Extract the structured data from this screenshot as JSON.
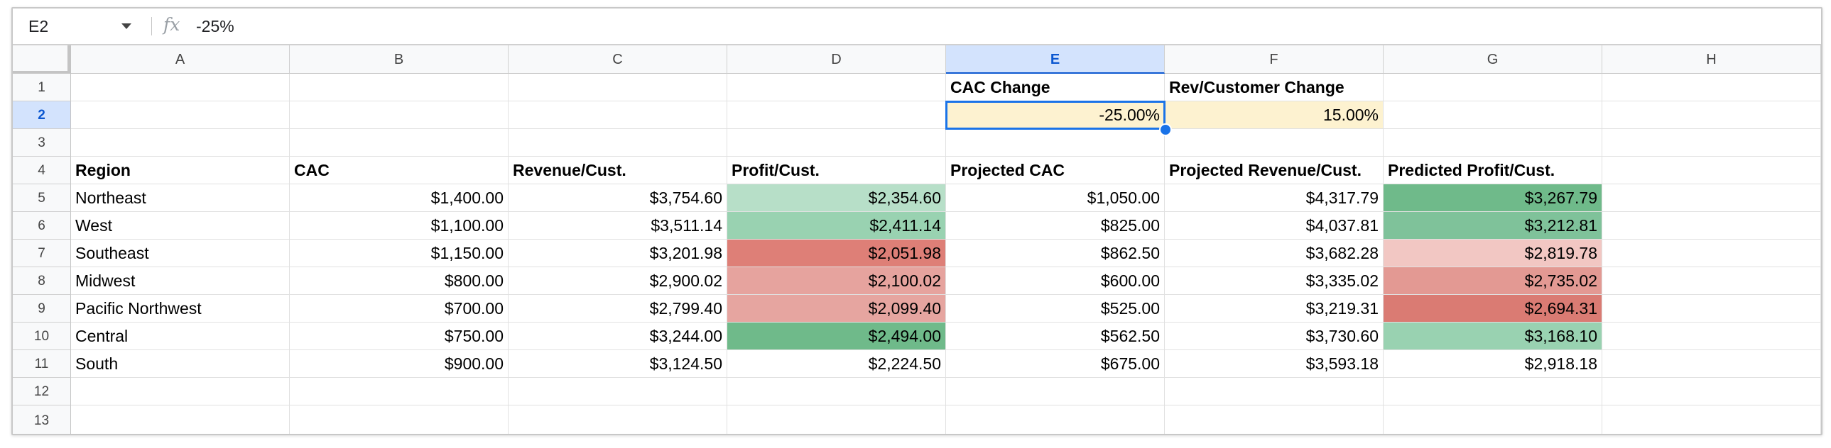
{
  "formula_bar": {
    "cell_ref": "E2",
    "fx_icon": "fx-icon",
    "formula": "-25%"
  },
  "columns": [
    "A",
    "B",
    "C",
    "D",
    "E",
    "F",
    "G",
    "H"
  ],
  "selected_column": "E",
  "selected_row": "2",
  "rows": [
    "1",
    "2",
    "3",
    "4",
    "5",
    "6",
    "7",
    "8",
    "9",
    "10",
    "11",
    "12",
    "13"
  ],
  "inputs": {
    "cac_change_label": "CAC Change",
    "cac_change_value": "-25.00%",
    "rev_change_label": "Rev/Customer Change",
    "rev_change_value": "15.00%"
  },
  "table": {
    "headers": [
      "Region",
      "CAC",
      "Revenue/Cust.",
      "Profit/Cust.",
      "Projected CAC",
      "Projected Revenue/Cust.",
      "Predicted Profit/Cust."
    ],
    "rows": [
      [
        "Northeast",
        "$1,400.00",
        "$3,754.60",
        "$2,354.60",
        "$1,050.00",
        "$4,317.79",
        "$3,267.79"
      ],
      [
        "West",
        "$1,100.00",
        "$3,511.14",
        "$2,411.14",
        "$825.00",
        "$4,037.81",
        "$3,212.81"
      ],
      [
        "Southeast",
        "$1,150.00",
        "$3,201.98",
        "$2,051.98",
        "$862.50",
        "$3,682.28",
        "$2,819.78"
      ],
      [
        "Midwest",
        "$800.00",
        "$2,900.02",
        "$2,100.02",
        "$600.00",
        "$3,335.02",
        "$2,735.02"
      ],
      [
        "Pacific Northwest",
        "$700.00",
        "$2,799.40",
        "$2,099.40",
        "$525.00",
        "$3,219.31",
        "$2,694.31"
      ],
      [
        "Central",
        "$750.00",
        "$3,244.00",
        "$2,494.00",
        "$562.50",
        "$3,730.60",
        "$3,168.10"
      ],
      [
        "South",
        "$900.00",
        "$3,124.50",
        "$2,224.50",
        "$675.00",
        "$3,593.18",
        "$2,918.18"
      ]
    ],
    "profit_fill_colors": [
      "#b7dfc8",
      "#99d2b1",
      "#de7f77",
      "#e6a39e",
      "#e6a5a0",
      "#6fba8a",
      "#ffffff"
    ],
    "predicted_fill_colors": [
      "#6fba8a",
      "#7fc29a",
      "#f2c7c3",
      "#e39993",
      "#da7b73",
      "#99d2b1",
      "#ffffff"
    ]
  },
  "colors": {
    "input_fill": "#fdf2d0",
    "selection": "#1a73e8",
    "header_fill": "#f8f9fa",
    "selected_header_fill": "#d3e3fd"
  }
}
